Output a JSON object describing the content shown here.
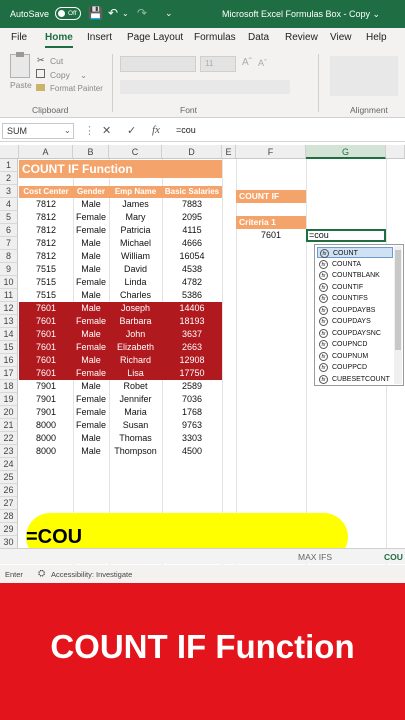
{
  "titlebar": {
    "autosave_label": "AutoSave",
    "autosave_state": "Off",
    "window_title": "Microsoft Excel Formulas Box - Copy ⌄"
  },
  "menu_tabs": [
    "File",
    "Home",
    "Insert",
    "Page Layout",
    "Formulas",
    "Data",
    "Review",
    "View",
    "Help"
  ],
  "active_tab": "Home",
  "ribbon": {
    "paste_label": "Paste",
    "cut_label": "Cut",
    "copy_label": "Copy",
    "format_painter_label": "Format Painter",
    "clipboard_group": "Clipboard",
    "font_size": "11",
    "font_group": "Font",
    "alignment_group": "Alignment"
  },
  "formula_bar": {
    "name_box": "SUM",
    "formula": "=cou"
  },
  "columns": [
    "A",
    "B",
    "C",
    "D",
    "E",
    "F",
    "G"
  ],
  "rows": [
    "1",
    "2",
    "3",
    "4",
    "5",
    "6",
    "7",
    "8",
    "9",
    "10",
    "11",
    "12",
    "13",
    "14",
    "15",
    "16",
    "17",
    "18",
    "19",
    "20",
    "21",
    "22",
    "23",
    "24",
    "25",
    "26",
    "27",
    "28",
    "29",
    "30"
  ],
  "sheet": {
    "title": "COUNT IF Function",
    "headers": [
      "Cost Center",
      "Gender",
      "Emp Name",
      "Basic Salaries"
    ],
    "data": [
      [
        "7812",
        "Male",
        "James",
        "7883"
      ],
      [
        "7812",
        "Female",
        "Mary",
        "2095"
      ],
      [
        "7812",
        "Female",
        "Patricia",
        "4115"
      ],
      [
        "7812",
        "Male",
        "Michael",
        "4666"
      ],
      [
        "7812",
        "Male",
        "William",
        "16054"
      ],
      [
        "7515",
        "Male",
        "David",
        "4538"
      ],
      [
        "7515",
        "Female",
        "Linda",
        "4782"
      ],
      [
        "7515",
        "Male",
        "Charles",
        "5386"
      ],
      [
        "7601",
        "Male",
        "Joseph",
        "14406"
      ],
      [
        "7601",
        "Female",
        "Barbara",
        "18193"
      ],
      [
        "7601",
        "Male",
        "John",
        "3637"
      ],
      [
        "7601",
        "Female",
        "Elizabeth",
        "2663"
      ],
      [
        "7601",
        "Male",
        "Richard",
        "12908"
      ],
      [
        "7601",
        "Female",
        "Lisa",
        "17750"
      ],
      [
        "7901",
        "Male",
        "Robet",
        "2589"
      ],
      [
        "7901",
        "Female",
        "Jennifer",
        "7036"
      ],
      [
        "7901",
        "Female",
        "Maria",
        "1768"
      ],
      [
        "8000",
        "Female",
        "Susan",
        "9763"
      ],
      [
        "8000",
        "Male",
        "Thomas",
        "3303"
      ],
      [
        "8000",
        "Male",
        "Thompson",
        "4500"
      ]
    ],
    "count_if_label": "COUNT IF",
    "criteria_label": "Criteria 1",
    "criteria_value": "7601",
    "active_cell_text": "=cou"
  },
  "autocomplete": [
    "COUNT",
    "COUNTA",
    "COUNTBLANK",
    "COUNTIF",
    "COUNTIFS",
    "COUPDAYBS",
    "COUPDAYS",
    "COUPDAYSNC",
    "COUPNCD",
    "COUPNUM",
    "COUPPCD",
    "CUBESETCOUNT"
  ],
  "overlay_formula": "=COU",
  "sheet_tabs": [
    "MAX IFS",
    "COU"
  ],
  "status": {
    "mode": "Enter",
    "accessibility": "Accessibility: Investigate"
  },
  "banner_text": "COUNT IF Function",
  "colors": {
    "excel_green": "#1f6e43",
    "header_orange": "#f4a46a",
    "highlight_red": "#b01a1f",
    "banner_red": "#e3141b",
    "overlay_yellow": "#ffff00"
  }
}
